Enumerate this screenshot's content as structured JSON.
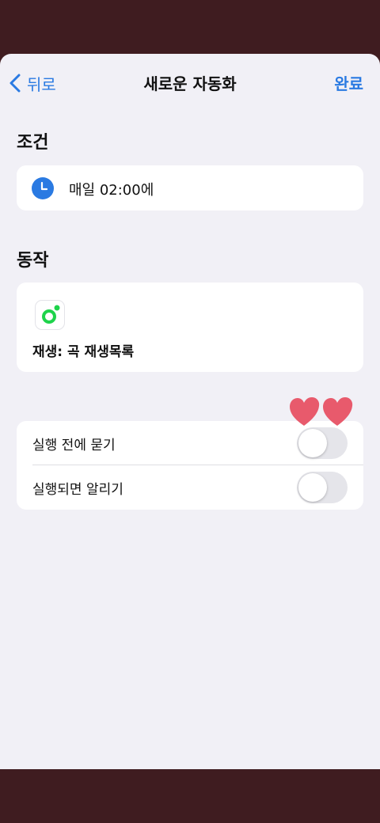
{
  "nav": {
    "back_label": "뒤로",
    "title": "새로운 자동화",
    "done_label": "완료"
  },
  "condition": {
    "section_title": "조건",
    "text": "매일 02:00에",
    "icon": "clock-icon"
  },
  "action": {
    "section_title": "동작",
    "text": "재생: 곡 재생목록",
    "icon": "music-app-icon"
  },
  "options": [
    {
      "label": "실행 전에 묻기",
      "state": "off"
    },
    {
      "label": "실행되면 알리기",
      "state": "off"
    }
  ],
  "colors": {
    "accent": "#2a7ae2",
    "background": "#f1f0f6",
    "outer": "#3f1c20",
    "app_green": "#1ed34b",
    "heart": "#e85a6c"
  }
}
